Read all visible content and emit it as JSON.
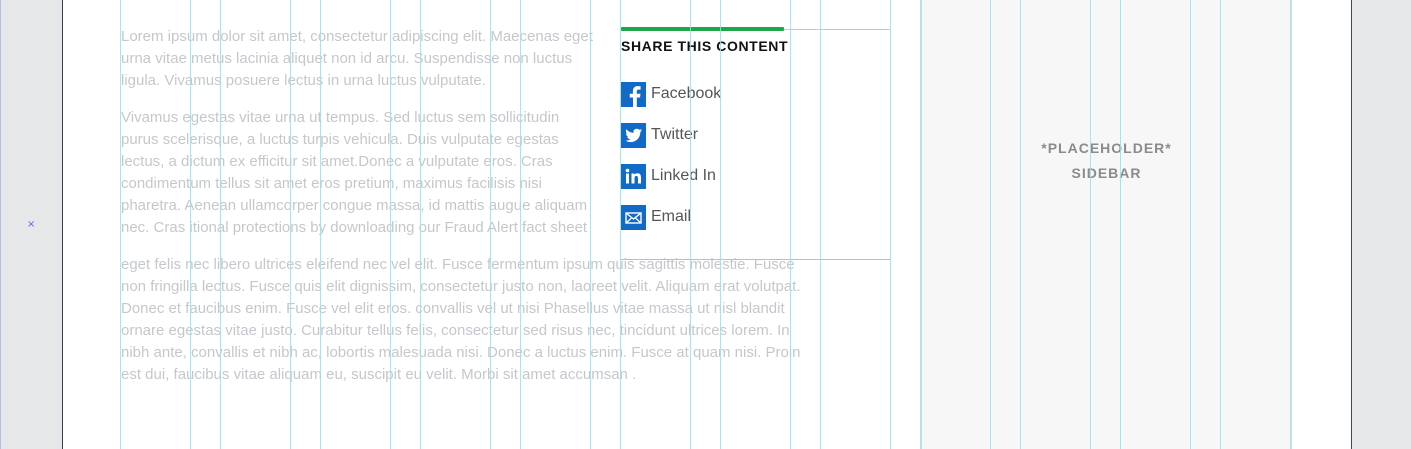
{
  "marker": "×",
  "body_paragraphs": [
    "Lorem ipsum dolor sit amet, consectetur adipiscing elit. Maecenas eget urna vitae metus lacinia aliquet non id arcu. Suspendisse non luctus ligula. Vivamus posuere lectus in urna luctus vulputate.",
    "Vivamus egestas vitae urna ut tempus. Sed luctus sem sollicitudin purus scelerisque, a luctus turpis vehicula. Duis vulputate egestas lectus, a dictum ex efficitur sit amet.Donec a vulputate eros. Cras condimentum tellus sit amet eros pretium, maximus facilisis nisi pharetra. Aenean ullamcorper congue massa, id mattis augue aliquam nec. Cras itional protections by downloading our Fraud Alert fact sheet",
    "eget felis nec libero ultrices eleifend nec vel elit. Fusce fermentum ipsum quis sagittis molestie. Fusce non fringilla lectus. Fusce quis elit dignissim, consectetur justo non, laoreet velit. Aliquam erat volutpat. Donec et faucibus enim. Fusce vel elit eros. convallis vel ut nisi Phasellus vitae massa ut nisl blandit ornare egestas vitae justo. Curabitur tellus felis, consectetur sed risus nec, tincidunt ultrices lorem. In nibh ante, convallis et nibh ac, lobortis malesuada nisi. Donec a luctus enim. Fusce at quam nisi. Proin est dui, faucibus vitae aliquam eu, suscipit eu velit. Morbi sit amet accumsan ."
  ],
  "share": {
    "title": "SHARE THIS CONTENT",
    "accent_color": "#1fa54a",
    "icon_color": "#1269c6",
    "items": [
      {
        "label": "Facebook",
        "icon": "facebook-icon"
      },
      {
        "label": "Twitter",
        "icon": "twitter-icon"
      },
      {
        "label": "Linked In",
        "icon": "linkedin-icon"
      },
      {
        "label": "Email",
        "icon": "email-icon"
      }
    ]
  },
  "sidebar": {
    "line1": "*PLACEHOLDER*",
    "line2": "SIDEBAR"
  }
}
